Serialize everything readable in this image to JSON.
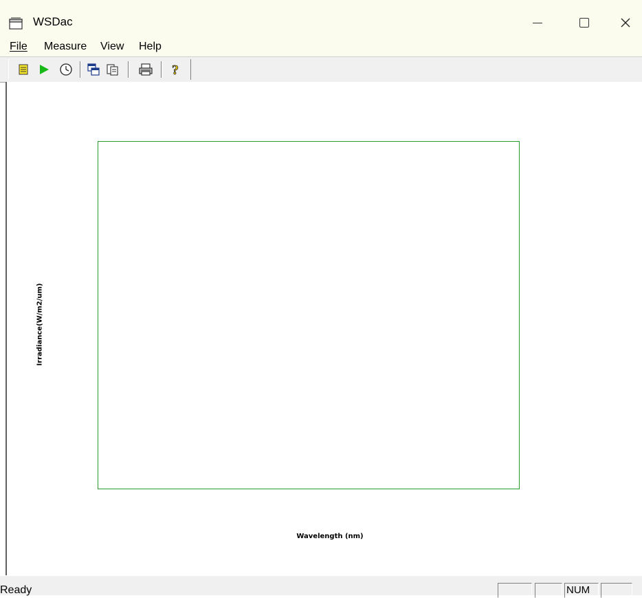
{
  "window": {
    "title": "WSDac",
    "icon": "window-app-icon"
  },
  "menu": {
    "file": "File",
    "measure": "Measure",
    "view": "View",
    "help": "Help"
  },
  "toolbar": {
    "buttons": [
      {
        "icon": "new-document-icon"
      },
      {
        "icon": "play-icon"
      },
      {
        "icon": "clock-icon"
      },
      {
        "icon": "copy-window-icon"
      },
      {
        "icon": "paste-icon"
      },
      {
        "icon": "print-icon"
      },
      {
        "icon": "help-question-icon"
      }
    ]
  },
  "plot": {
    "xlabel": "Wavelength (nm)",
    "ylabel": "Irradiance(W/m2/um)",
    "frame_color": "#2a9a2a"
  },
  "statusbar": {
    "status": "Ready",
    "panes": [
      "",
      "",
      "NUM",
      ""
    ]
  }
}
